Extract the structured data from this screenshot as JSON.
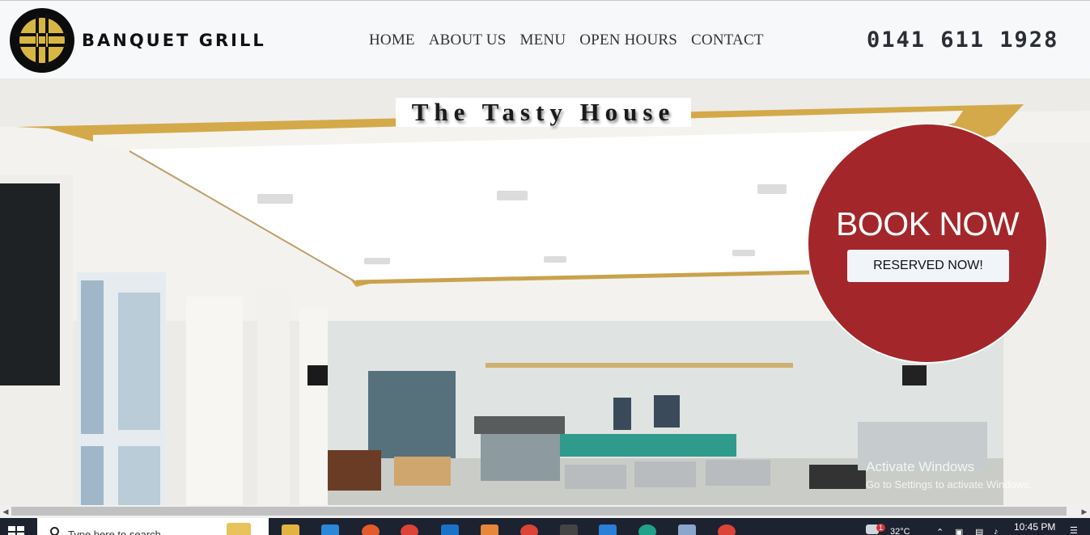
{
  "header": {
    "brand": "BANQUET GRILL",
    "nav": [
      "HOME",
      "ABOUT US",
      "MENU",
      "OPEN HOURS",
      "CONTACT"
    ],
    "phone": "0141 611 1928"
  },
  "hero": {
    "title": "The Tasty House",
    "book_title": "BOOK NOW",
    "reserve_label": "RESERVED NOW!",
    "watermark_line1": "Activate Windows",
    "watermark_line2": "Go to Settings to activate Windows."
  },
  "taskbar": {
    "search_placeholder": "Type here to search",
    "weather": "32°C",
    "time": "10:45 PM",
    "notification_count": "1"
  },
  "colors": {
    "book_red": "#a3272a",
    "header_bg": "#f7f8f9",
    "taskbar_bg": "#1c2230",
    "logo_gold": "#d8b645"
  }
}
